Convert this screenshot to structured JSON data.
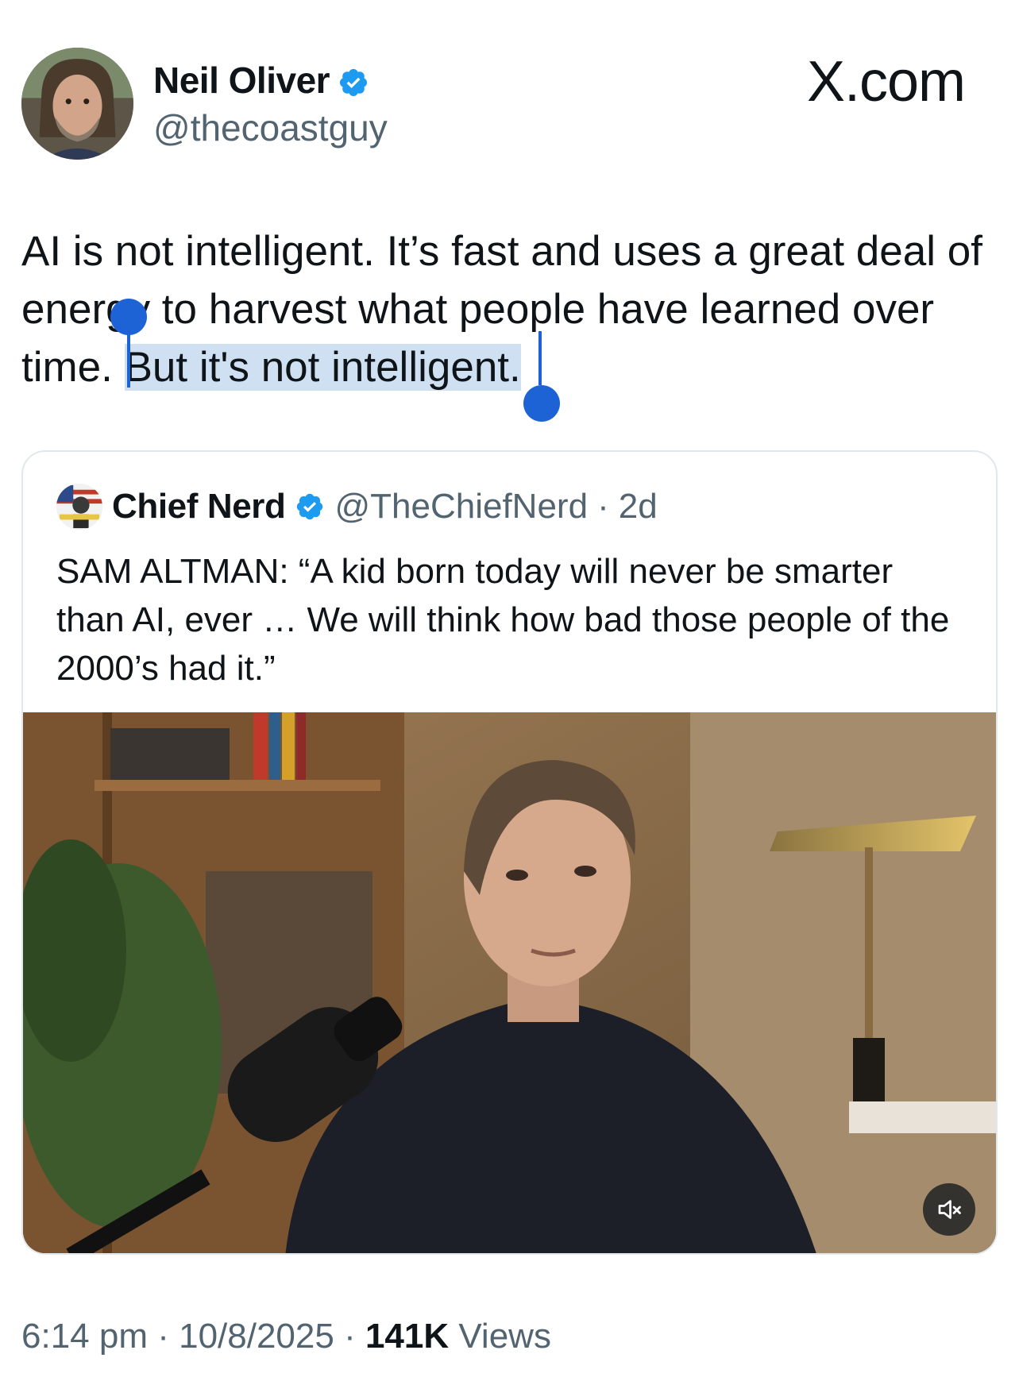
{
  "author": {
    "name": "Neil Oliver",
    "handle": "@thecoastguy",
    "verified": true,
    "avatar_icon": "profile-photo-bearded-man"
  },
  "brand": {
    "text": "X.com"
  },
  "tweet": {
    "text_before_selection": "AI is not intelligent. It’s fast and uses a great deal of en",
    "text_under_handle": "e",
    "text_mid": "rgy to harvest what people have learned over time. ",
    "selected_text": "But it's not intelligent.",
    "selection_color": "#cfe0f3",
    "handle_color": "#1d63d6"
  },
  "quote": {
    "name": "Chief Nerd",
    "handle": "@TheChiefNerd",
    "separator": "·",
    "age": "2d",
    "verified": true,
    "avatar_icon": "chief-nerd-logo",
    "text": "SAM ALTMAN: “A kid born today will never be smarter than AI, ever … We will think how bad those people of the 2000’s had it.”",
    "media": {
      "type": "video",
      "muted": true,
      "mute_icon": "speaker-muted-icon"
    }
  },
  "footer": {
    "time": "6:14 pm",
    "sep1": " · ",
    "date": "10/8/2025",
    "sep2": " · ",
    "views_count": "141K",
    "views_label": " Views"
  },
  "colors": {
    "verified_blue": "#1d9bf0",
    "secondary_text": "#536471",
    "primary_text": "#0f1419"
  }
}
